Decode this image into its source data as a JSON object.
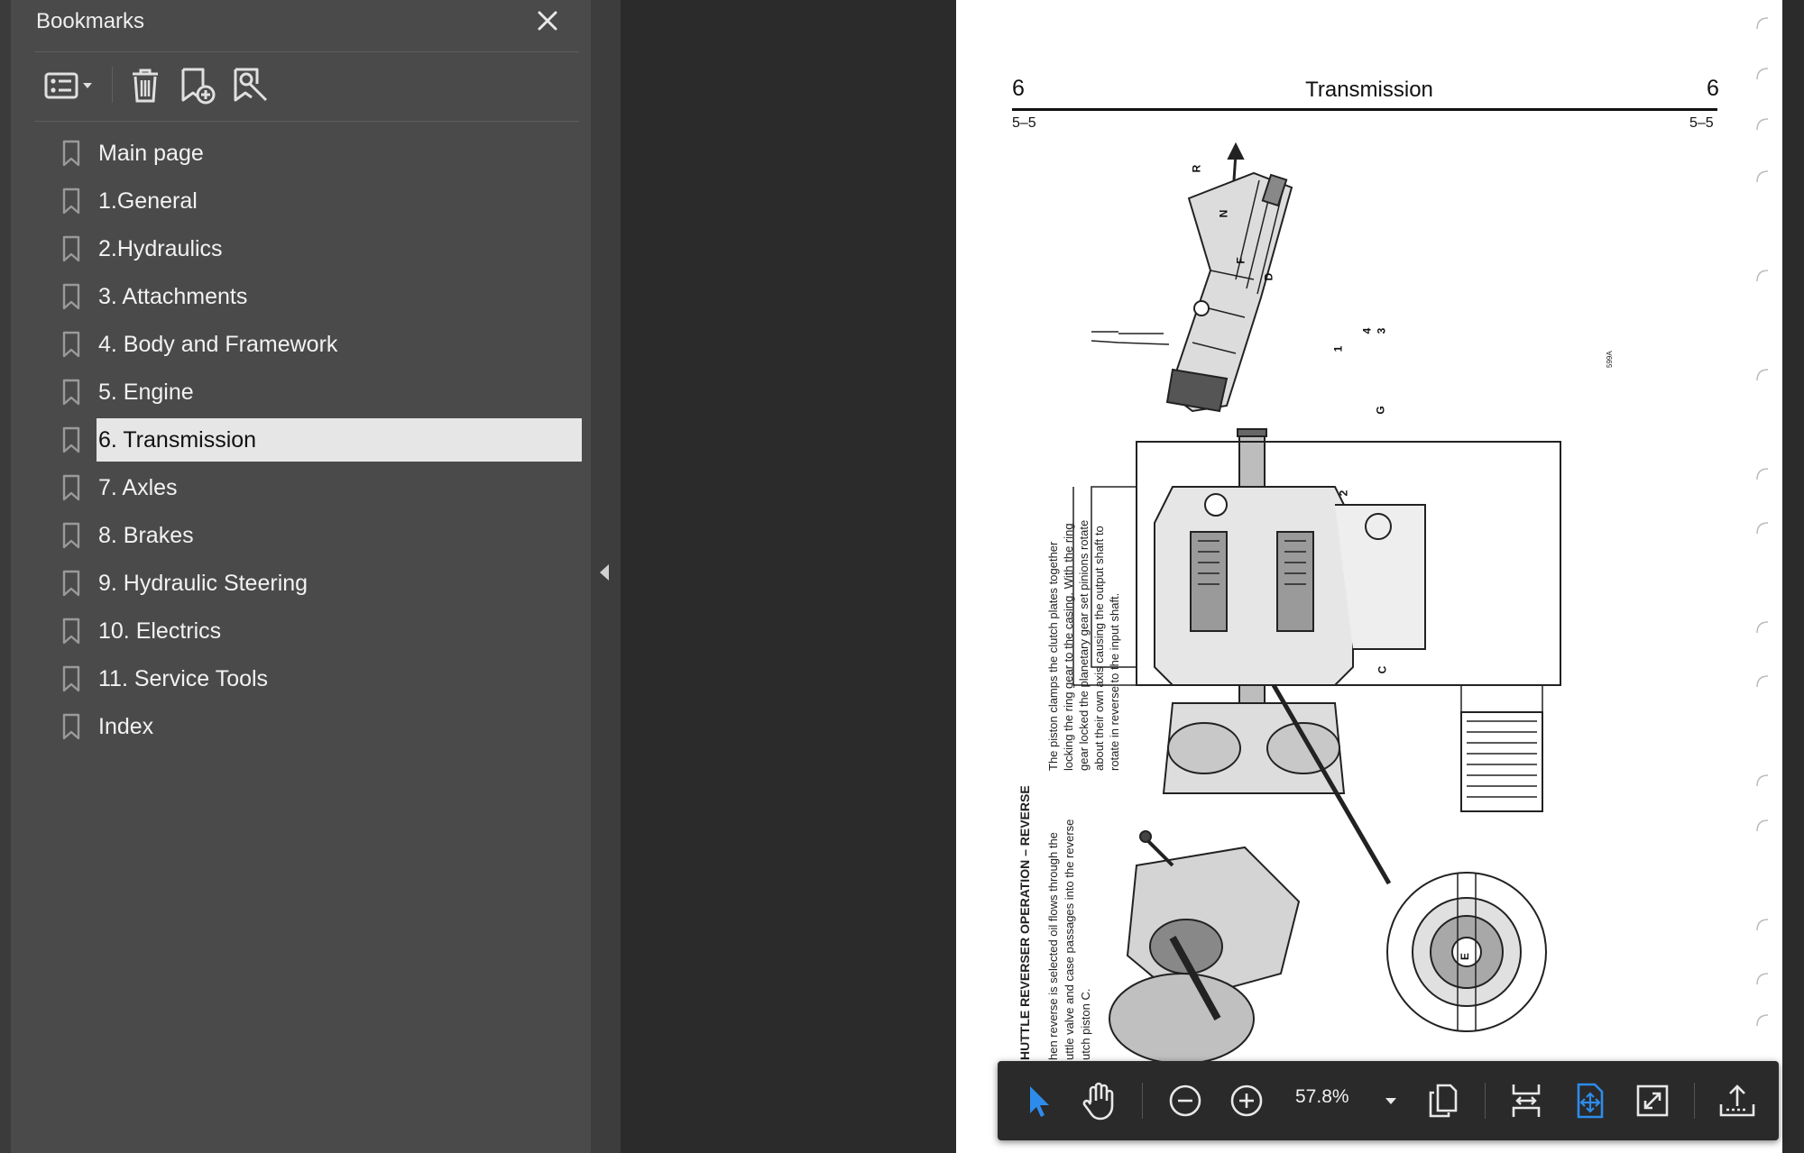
{
  "bookmarks_panel": {
    "title": "Bookmarks",
    "toolbar": {
      "options_icon": "list-options-icon",
      "delete_icon": "trash-icon",
      "add_icon": "add-bookmark-icon",
      "find_icon": "find-bookmark-icon"
    },
    "items": [
      {
        "label": "Main page",
        "selected": false
      },
      {
        "label": "1.General",
        "selected": false
      },
      {
        "label": "2.Hydraulics",
        "selected": false
      },
      {
        "label": "3. Attachments",
        "selected": false
      },
      {
        "label": "4. Body and Framework",
        "selected": false
      },
      {
        "label": "5. Engine",
        "selected": false
      },
      {
        "label": "6. Transmission",
        "selected": true
      },
      {
        "label": "7. Axles",
        "selected": false
      },
      {
        "label": "8. Brakes",
        "selected": false
      },
      {
        "label": "9. Hydraulic Steering",
        "selected": false
      },
      {
        "label": "10. Electrics",
        "selected": false
      },
      {
        "label": "11. Service Tools",
        "selected": false
      },
      {
        "label": "Index",
        "selected": false
      }
    ]
  },
  "page": {
    "section_left": "6",
    "section_right": "6",
    "title": "Transmission",
    "page_left": "5–5",
    "page_right": "5–5",
    "heading": "HUTTLE REVERSER OPERATION – REVERSE",
    "body_left": [
      "hen reverse is selected oil flows through the",
      "uttle valve and case passages into the reverse",
      "utch piston C."
    ],
    "body_right": [
      "The piston clamps the clutch plates together",
      "locking the ring gear to the casing. With the ring",
      "gear locked the planetary gear set pinions rotate",
      "about their own axis causing the output shaft to",
      "rotate in reverse to the input shaft."
    ],
    "figure_labels": [
      "R",
      "N",
      "F",
      "D",
      "G",
      "C",
      "E",
      "1",
      "2",
      "3",
      "4"
    ],
    "figure_ref": "599A"
  },
  "bottom_toolbar": {
    "zoom": "57.8%",
    "tools": [
      "select-arrow-icon",
      "hand-icon",
      "zoom-out-icon",
      "zoom-in-icon",
      "page-thumbnails-icon",
      "fit-width-icon",
      "fit-page-icon",
      "fullscreen-icon",
      "share-icon"
    ],
    "accent_color": "#2d8ceb"
  }
}
